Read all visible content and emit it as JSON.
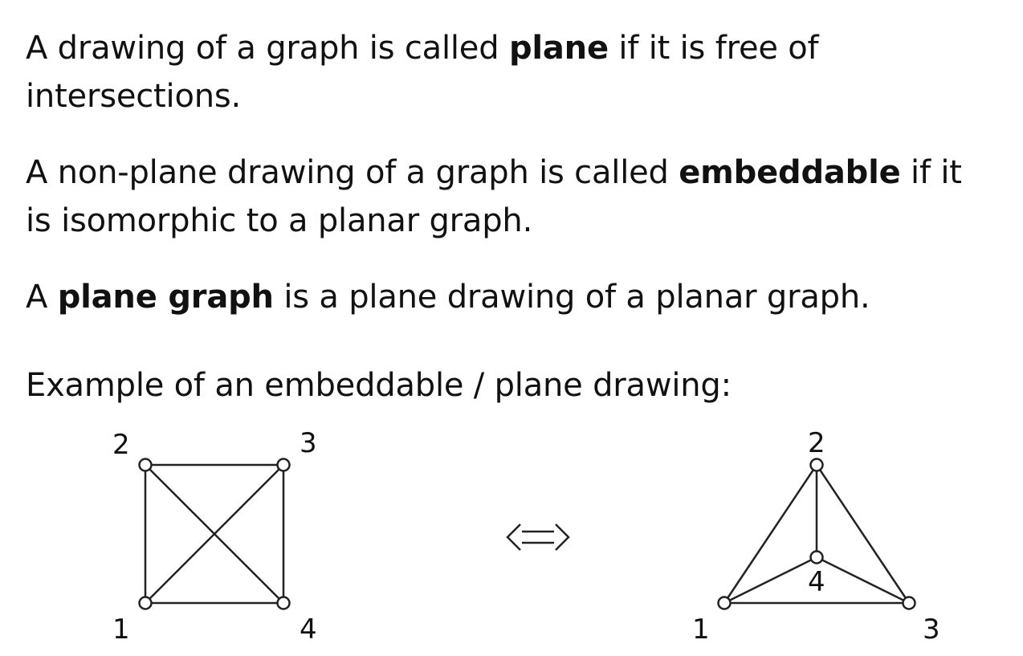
{
  "paragraphs": [
    {
      "line1_pre": "A drawing of a graph is called ",
      "line1_bold": "plane",
      "line1_post": " if it is free of",
      "line2": "intersections."
    },
    {
      "line1_pre": "A non-plane drawing of a graph is called ",
      "line1_bold": "embeddable",
      "line1_post": " if it",
      "line2": "is isomorphic to a planar graph."
    },
    {
      "pre": "A ",
      "bold": "plane graph",
      "post": " is a plane drawing of a planar graph."
    },
    {
      "text": "Example of an embeddable / plane drawing:"
    }
  ],
  "left_graph": {
    "vertex_labels": [
      "1",
      "2",
      "3",
      "4"
    ]
  },
  "right_graph": {
    "vertex_labels": [
      "1",
      "2",
      "3",
      "4"
    ]
  }
}
